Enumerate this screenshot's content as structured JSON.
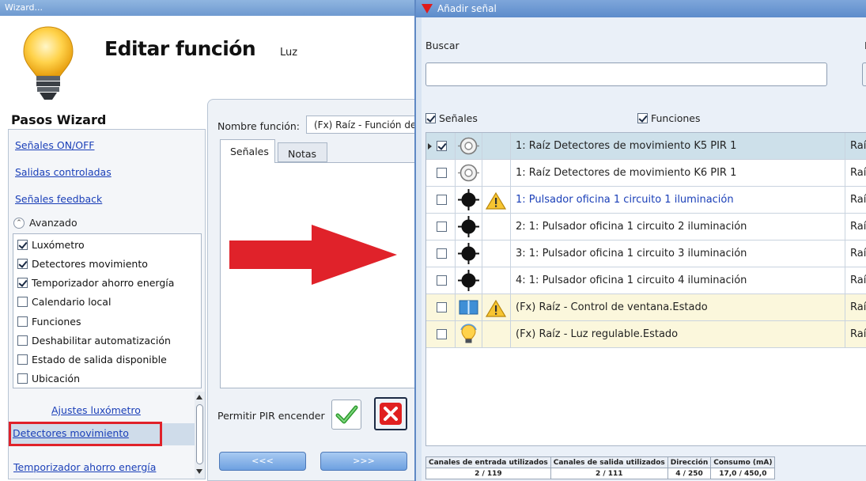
{
  "wizard": {
    "window_title": "Wizard...",
    "title": "Editar función",
    "subtitle": "Luz",
    "steps_header": "Pasos Wizard",
    "steps": [
      {
        "label": "Señales ON/OFF"
      },
      {
        "label": "Salidas controladas"
      },
      {
        "label": "Señales feedback"
      }
    ],
    "advanced_label": "Avanzado",
    "advanced_items": [
      {
        "label": "Luxómetro",
        "checked": true
      },
      {
        "label": "Detectores movimiento",
        "checked": true
      },
      {
        "label": "Temporizador ahorro energía",
        "checked": true
      },
      {
        "label": "Calendario local",
        "checked": false
      },
      {
        "label": "Funciones",
        "checked": false
      },
      {
        "label": "Deshabilitar automatización",
        "checked": false
      },
      {
        "label": "Estado de salida disponible",
        "checked": false
      },
      {
        "label": "Ubicación",
        "checked": false
      }
    ],
    "sub_steps": {
      "ajustes": "Ajustes luxómetro",
      "detectores": "Detectores movimiento",
      "temporizador": "Temporizador ahorro energía"
    },
    "function_name_label": "Nombre función:",
    "function_name_value": "(Fx) Raíz - Función de",
    "tabs": {
      "senales": "Señales",
      "notas": "Notas"
    },
    "pir_label": "Permitir PIR encender",
    "nav_prev": "<<<",
    "nav_next": ">>>"
  },
  "add_signal": {
    "window_title": "Añadir señal",
    "search_label": "Buscar",
    "search_value": "",
    "search_right_glyph": "I",
    "filters": {
      "senales": {
        "label": "Señales",
        "checked": true
      },
      "funciones": {
        "label": "Funciones",
        "checked": true
      },
      "third": {
        "label": "",
        "checked": false
      }
    },
    "rows": [
      {
        "checked": true,
        "icon": "motion-sensor-icon",
        "warning": false,
        "name": "1: Raíz Detectores de movimiento K5 PIR 1",
        "origin": "Raí",
        "style": "sel",
        "name_color": "normal"
      },
      {
        "checked": false,
        "icon": "motion-sensor-icon",
        "warning": false,
        "name": "1: Raíz Detectores de movimiento K6 PIR 1",
        "origin": "Raí",
        "style": "white",
        "name_color": "normal"
      },
      {
        "checked": false,
        "icon": "pushbutton-icon",
        "warning": true,
        "name": "1: Pulsador oficina 1 circuito 1 iluminación",
        "origin": "Raí",
        "style": "white",
        "name_color": "blue"
      },
      {
        "checked": false,
        "icon": "pushbutton-icon",
        "warning": false,
        "name": "2: 1: Pulsador oficina 1 circuito 2 iluminación",
        "origin": "Raí",
        "style": "white",
        "name_color": "normal"
      },
      {
        "checked": false,
        "icon": "pushbutton-icon",
        "warning": false,
        "name": "3: 1: Pulsador oficina 1 circuito 3 iluminación",
        "origin": "Raí",
        "style": "white",
        "name_color": "normal"
      },
      {
        "checked": false,
        "icon": "pushbutton-icon",
        "warning": false,
        "name": "4: 1: Pulsador oficina 1 circuito 4 iluminación",
        "origin": "Raí",
        "style": "white",
        "name_color": "normal"
      },
      {
        "checked": false,
        "icon": "window-icon",
        "warning": true,
        "name": "(Fx) Raíz - Control de ventana.Estado",
        "origin": "Raí",
        "style": "yellow",
        "name_color": "normal"
      },
      {
        "checked": false,
        "icon": "light-bulb-icon",
        "warning": false,
        "name": "(Fx) Raíz - Luz regulable.Estado",
        "origin": "Raí",
        "style": "yellow",
        "name_color": "normal"
      }
    ],
    "usage": {
      "headers": [
        "Canales de entrada utilizados",
        "Canales de salida utilizados",
        "Dirección",
        "Consumo (mA)"
      ],
      "values": [
        "2 / 119",
        "2 / 111",
        "4 / 250",
        "17,0 / 450,0"
      ]
    }
  },
  "colors": {
    "accent_red": "#e0222a",
    "link_blue": "#1a3fb8",
    "selected_row": "#cde0ea",
    "function_row": "#fbf7dc"
  }
}
